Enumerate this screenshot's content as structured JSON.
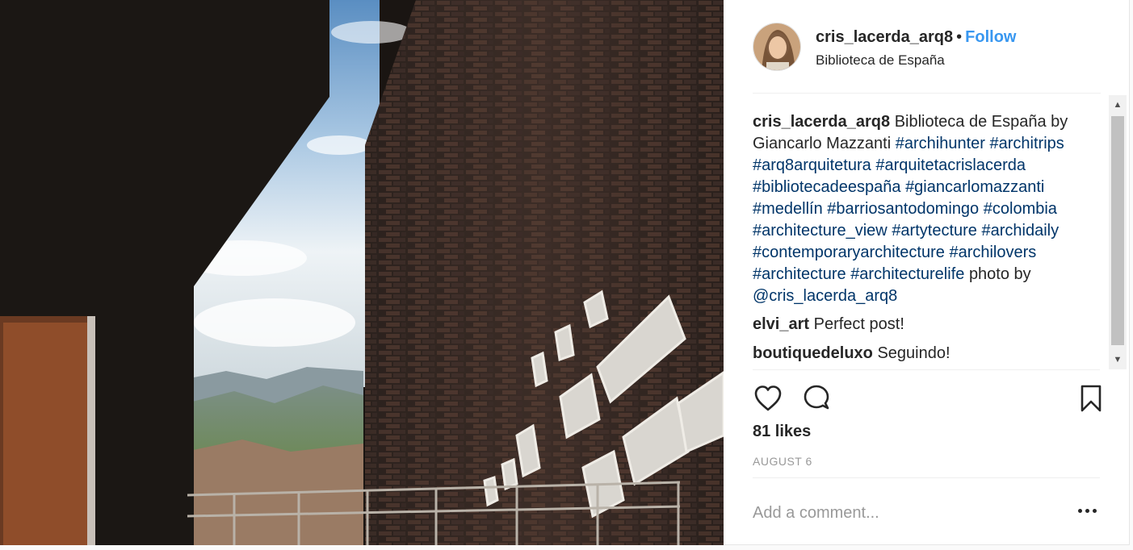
{
  "post": {
    "image": {
      "subject": "brick-building-photo"
    },
    "header": {
      "username": "cris_lacerda_arq8",
      "separator": "•",
      "follow_label": "Follow",
      "location": "Biblioteca de España"
    },
    "caption": {
      "username": "cris_lacerda_arq8",
      "text_before": "Biblioteca de España by Giancarlo Mazzanti",
      "hashtags": [
        "#archihunter",
        "#architrips",
        "#arq8arquitetura",
        "#arquitetacrislacerda",
        "#bibliotecadeespaña",
        "#giancarlomazzanti",
        "#medellín",
        "#barriosantodomingo",
        "#colombia",
        "#architecture_view",
        "#artytecture",
        "#archidaily",
        "#contemporaryarchitecture",
        "#archilovers",
        "#architecture",
        "#architecturelife"
      ],
      "text_after": "photo by",
      "mention": "@cris_lacerda_arq8"
    },
    "comments": [
      {
        "username": "elvi_art",
        "text": "Perfect post!"
      },
      {
        "username": "boutiquedeluxo",
        "text": "Seguindo!"
      }
    ],
    "actions": {
      "like_icon": "heart-icon",
      "comment_icon": "speech-bubble-icon",
      "save_icon": "bookmark-icon"
    },
    "likes": "81 likes",
    "date": "AUGUST 6",
    "add_comment": {
      "placeholder": "Add a comment...",
      "more_icon": "ellipsis-icon"
    }
  },
  "colors": {
    "link": "#3897f0",
    "hashtag": "#003569",
    "muted": "#999999",
    "text": "#262626"
  }
}
